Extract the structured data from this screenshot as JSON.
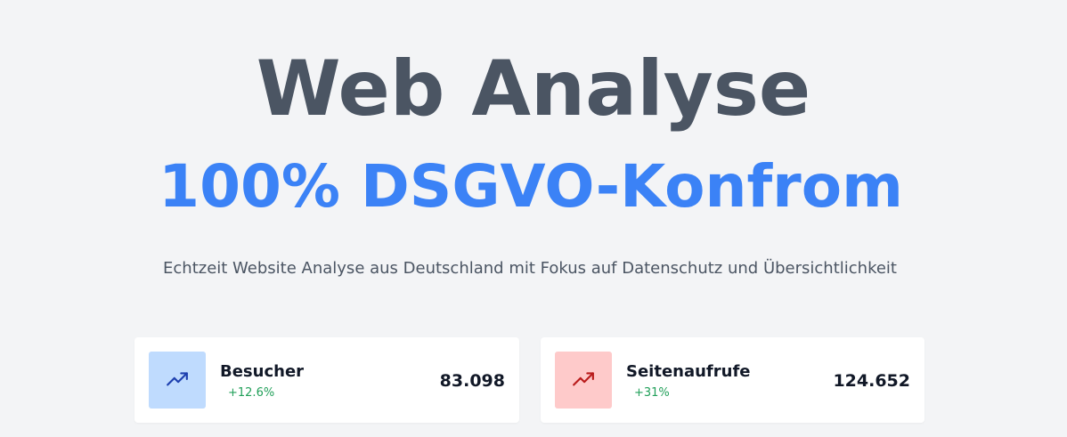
{
  "hero": {
    "title": "Web Analyse",
    "subtitle": "100% DSGVO-Konfrom",
    "tagline": "Echtzeit Website Analyse aus Deutschland mit Fokus auf Datenschutz und Übersichtlichkeit"
  },
  "stats": [
    {
      "label": "Besucher",
      "change": "+12.6%",
      "value": "83.098",
      "icon": "trending-up-icon",
      "icon_color": "#1e40af",
      "icon_bg": "#bfdbfe"
    },
    {
      "label": "Seitenaufrufe",
      "change": "+31%",
      "value": "124.652",
      "icon": "trending-up-icon",
      "icon_color": "#b91c1c",
      "icon_bg": "#fecaca"
    }
  ],
  "colors": {
    "background": "#f3f4f6",
    "title": "#4b5563",
    "accent": "#3b82f6",
    "positive": "#22a05a"
  }
}
